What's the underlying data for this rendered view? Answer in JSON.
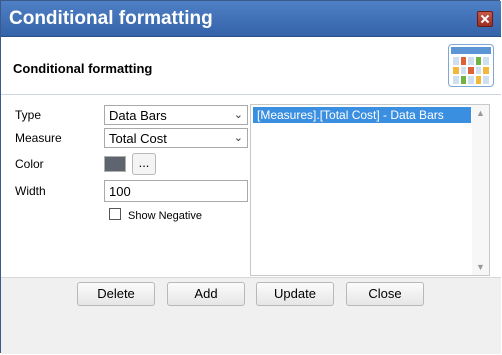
{
  "window": {
    "title": "Conditional formatting"
  },
  "header": {
    "title": "Conditional formatting",
    "icon": "calendar-grid-icon"
  },
  "form": {
    "type_label": "Type",
    "type_value": "Data Bars",
    "measure_label": "Measure",
    "measure_value": "Total Cost",
    "color_label": "Color",
    "color_value": "#5e6470",
    "color_picker_label": "...",
    "width_label": "Width",
    "width_value": "100",
    "show_negative_label": "Show Negative",
    "show_negative_checked": false
  },
  "rules_list": {
    "items": [
      "[Measures].[Total Cost] - Data Bars"
    ],
    "selected_index": 0
  },
  "buttons": {
    "delete": "Delete",
    "add": "Add",
    "update": "Update",
    "close": "Close"
  },
  "colors": {
    "title_bar": "#3b6cb5",
    "selection": "#3b8fe0",
    "close_button": "#b03a2e"
  }
}
